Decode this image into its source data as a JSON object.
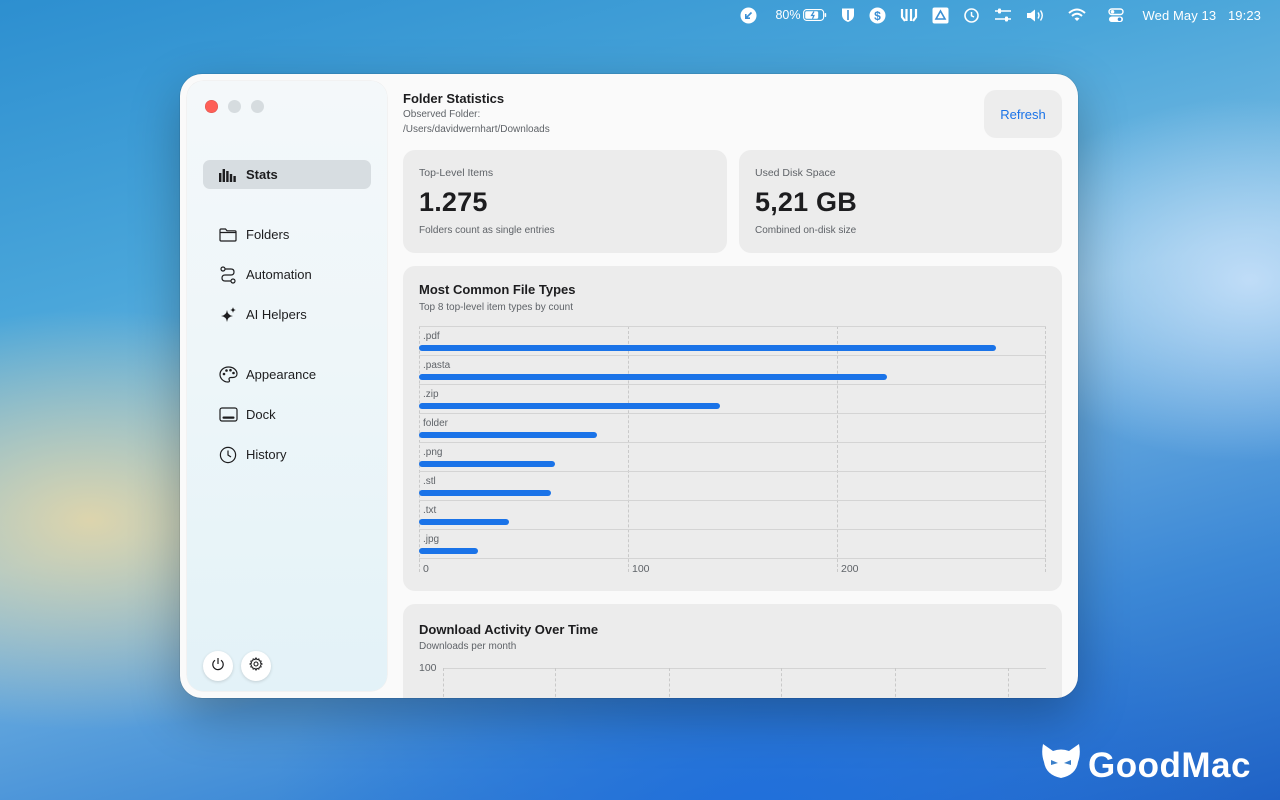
{
  "menubar": {
    "battery_percent": "80%",
    "date": "Wed May 13",
    "time": "19:23",
    "icons": [
      "download-arrow-icon",
      "battery-icon",
      "shield-icon",
      "dollar-circle-icon",
      "bracket-icon",
      "drive-icon",
      "history-icon",
      "sliders-icon",
      "volume-icon",
      "wifi-icon",
      "control-center-icon"
    ]
  },
  "sidebar": {
    "items": [
      {
        "label": "Stats",
        "icon": "chart-bars-icon",
        "active": true
      },
      {
        "label": "Folders",
        "icon": "folder-icon"
      },
      {
        "label": "Automation",
        "icon": "path-icon"
      },
      {
        "label": "AI Helpers",
        "icon": "sparkles-icon"
      },
      {
        "label": "Appearance",
        "icon": "palette-icon"
      },
      {
        "label": "Dock",
        "icon": "dock-icon"
      },
      {
        "label": "History",
        "icon": "clock-icon"
      }
    ],
    "footer_buttons": [
      "power-icon",
      "gear-icon"
    ]
  },
  "header": {
    "title": "Folder Statistics",
    "observed_label": "Observed Folder:",
    "observed_path": "/Users/davidwernhart/Downloads",
    "refresh_label": "Refresh"
  },
  "cards": {
    "items": {
      "label": "Top-Level Items",
      "value": "1.275",
      "caption": "Folders count as single entries"
    },
    "disk": {
      "label": "Used Disk Space",
      "value": "5,21 GB",
      "caption": "Combined on-disk size"
    }
  },
  "file_types": {
    "title": "Most Common File Types",
    "subtitle": "Top 8 top-level item types by count"
  },
  "activity": {
    "title": "Download Activity Over Time",
    "subtitle": "Downloads per month"
  },
  "chart_data": [
    {
      "type": "bar",
      "orientation": "horizontal",
      "title": "Most Common File Types",
      "subtitle": "Top 8 top-level item types by count",
      "categories": [
        ".pdf",
        ".pasta",
        ".zip",
        "folder",
        ".png",
        ".stl",
        ".txt",
        ".jpg"
      ],
      "values": [
        276,
        224,
        144,
        85,
        65,
        63,
        43,
        28
      ],
      "xlim": [
        0,
        300
      ],
      "xticks": [
        0,
        100,
        200
      ],
      "grid": true,
      "color": "#1a73e8"
    },
    {
      "type": "line",
      "title": "Download Activity Over Time",
      "subtitle": "Downloads per month",
      "yticks": [
        100
      ],
      "grid": true
    }
  ],
  "watermark": "GoodMac"
}
